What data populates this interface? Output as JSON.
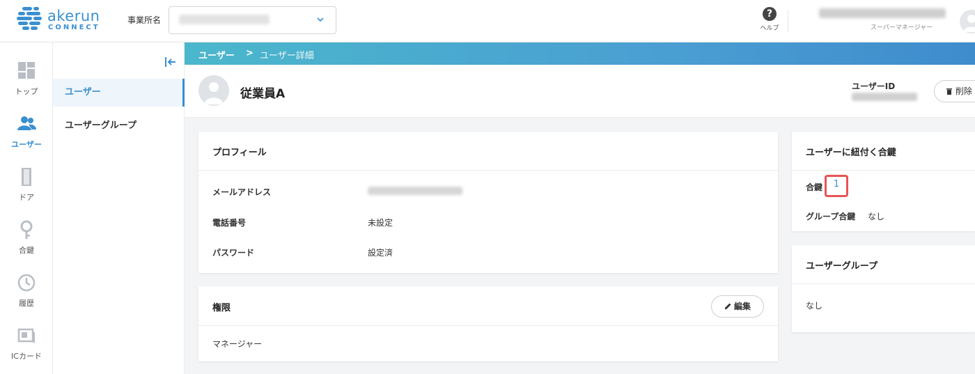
{
  "header": {
    "logo_text": "akerun",
    "logo_sub": "CONNECT",
    "office_label": "事業所名",
    "office_value": "",
    "help_label": "ヘルプ",
    "user_name": "",
    "user_role": "スーパーマネージャー"
  },
  "rail": {
    "items": [
      {
        "label": "トップ",
        "icon": "dashboard-icon"
      },
      {
        "label": "ユーザー",
        "icon": "users-icon"
      },
      {
        "label": "ドア",
        "icon": "door-icon"
      },
      {
        "label": "合鍵",
        "icon": "key-icon"
      },
      {
        "label": "履歴",
        "icon": "history-icon"
      },
      {
        "label": "ICカード",
        "icon": "ic-card-icon"
      }
    ],
    "active": "ユーザー"
  },
  "subnav": {
    "items": [
      {
        "label": "ユーザー"
      },
      {
        "label": "ユーザーグループ"
      }
    ]
  },
  "breadcrumb": {
    "parent": "ユーザー",
    "separator": ">",
    "current": "ユーザー詳細"
  },
  "detail": {
    "name": "従業員A",
    "user_id_label": "ユーザーID",
    "user_id_value": "",
    "delete_label": "削除"
  },
  "profile": {
    "title": "プロフィール",
    "email_label": "メールアドレス",
    "email_value": "",
    "phone_label": "電話番号",
    "phone_value": "未設定",
    "password_label": "パスワード",
    "password_value": "設定済"
  },
  "permission": {
    "title": "権限",
    "edit_label": "編集",
    "value": "マネージャー"
  },
  "keys": {
    "title": "ユーザーに紐付く合鍵",
    "key_label": "合鍵",
    "key_count": "1",
    "group_key_label": "グループ合鍵",
    "group_key_value": "なし"
  },
  "groups": {
    "title": "ユーザーグループ",
    "value": "なし"
  },
  "colors": {
    "accent": "#3a8fcf",
    "highlight": "#e85454"
  }
}
